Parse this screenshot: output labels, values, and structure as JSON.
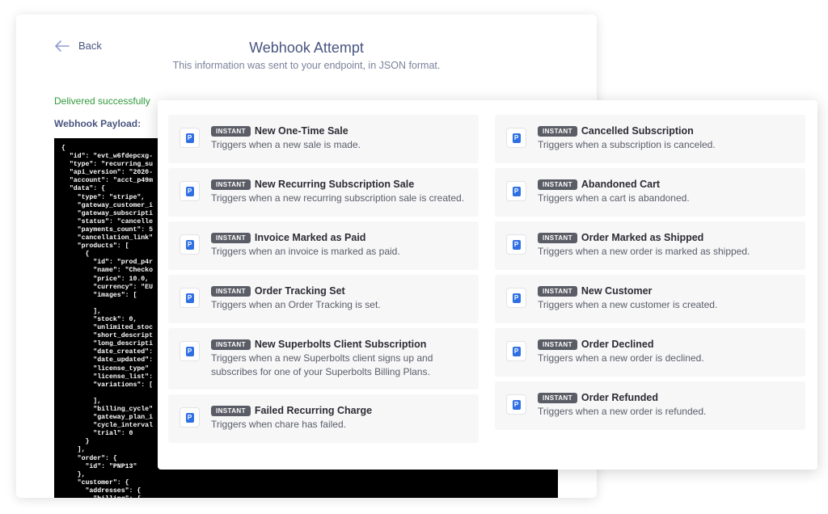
{
  "header": {
    "back_label": "Back",
    "title": "Webhook Attempt",
    "subtitle": "This information was sent to your endpoint, in JSON format."
  },
  "status_text": "Delivered successfully",
  "payload_label": "Webhook Payload:",
  "payload_lines": [
    "{",
    "  \"id\": \"evt_w6fdepcxg-",
    "  \"type\": \"recurring_su",
    "  \"api_version\": \"2020-",
    "  \"account\": \"acct_p49m",
    "  \"data\": {",
    "    \"type\": \"stripe\",",
    "    \"gateway_customer_i",
    "    \"gateway_subscripti",
    "    \"status\": \"cancelle",
    "    \"payments_count\": 5",
    "    \"cancellation_link\"",
    "    \"products\": [",
    "      {",
    "        \"id\": \"prod_p4r",
    "        \"name\": \"Checko",
    "        \"price\": 10.0,",
    "        \"currency\": \"EU",
    "        \"images\": [",
    "",
    "        ],",
    "        \"stock\": 0,",
    "        \"unlimited_stoc",
    "        \"short_descript",
    "        \"long_descripti",
    "        \"date_created\":",
    "        \"date_updated\":",
    "        \"license_type\"",
    "        \"license_list\":",
    "        \"variations\": [",
    "",
    "        ],",
    "        \"billing_cycle\"",
    "        \"gateway_plan_i",
    "        \"cycle_interval",
    "        \"trial\": 0",
    "      }",
    "    ],",
    "    \"order\": {",
    "      \"id\": \"PNP13\"",
    "    },",
    "    \"customer\": {",
    "      \"addresses\": {",
    "        \"billing\": {"
  ],
  "badge_label": "INSTANT",
  "app_icon_letter": "P",
  "colors": {
    "accent_blue": "#2f6fe4",
    "success_green": "#2f9a3a",
    "header_text": "#4a5580",
    "badge_bg": "#5b5d66"
  },
  "triggers_left": [
    {
      "name": "New One-Time Sale",
      "description": "Triggers when a new sale is made."
    },
    {
      "name": "New Recurring Subscription Sale",
      "description": "Triggers when a new recurring subscription sale is created."
    },
    {
      "name": "Invoice Marked as Paid",
      "description": "Triggers when an invoice is marked as paid."
    },
    {
      "name": "Order Tracking Set",
      "description": "Triggers when an Order Tracking is set."
    },
    {
      "name": "New Superbolts Client Subscription",
      "description": "Triggers when a new Superbolts client signs up and subscribes for one of your Superbolts Billing Plans."
    },
    {
      "name": "Failed Recurring Charge",
      "description": "Triggers when chare has failed."
    }
  ],
  "triggers_right": [
    {
      "name": "Cancelled Subscription",
      "description": "Triggers when a subscription is canceled."
    },
    {
      "name": "Abandoned Cart",
      "description": "Triggers when a cart is abandoned."
    },
    {
      "name": "Order Marked as Shipped",
      "description": "Triggers when a new order is marked as shipped."
    },
    {
      "name": "New Customer",
      "description": "Triggers when a new customer is created."
    },
    {
      "name": "Order Declined",
      "description": "Triggers when a new order is declined."
    },
    {
      "name": "Order Refunded",
      "description": "Triggers when a new order is refunded."
    }
  ]
}
